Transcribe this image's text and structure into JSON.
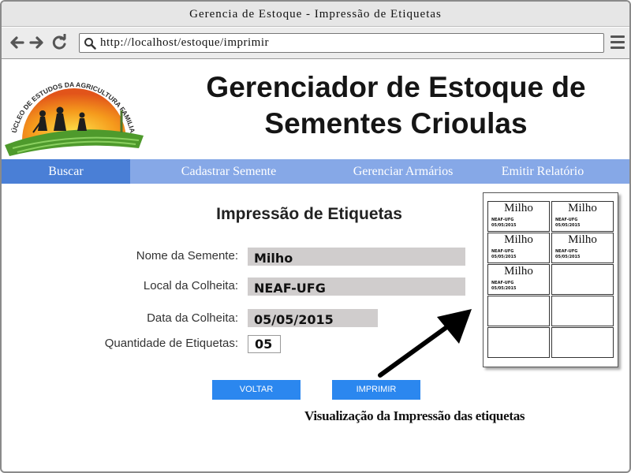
{
  "window": {
    "title": "Gerencia de Estoque - Impressão de Etiquetas"
  },
  "toolbar": {
    "url": "http://localhost/estoque/imprimir",
    "icons": [
      "back-arrow-icon",
      "forward-arrow-icon",
      "reload-icon",
      "search-icon",
      "menu-icon"
    ]
  },
  "header": {
    "logo_text": "NÚCLEO DE ESTUDOS DA AGRICULTURA FAMILIAR",
    "title_line1": "Gerenciador de Estoque de",
    "title_line2": "Sementes Crioulas"
  },
  "nav": {
    "items": [
      {
        "label": "Buscar",
        "active": true
      },
      {
        "label": "Cadastrar Semente",
        "active": false
      },
      {
        "label": "Gerenciar Armários",
        "active": false
      },
      {
        "label": "Emitir Relatório",
        "active": false
      }
    ],
    "colors": {
      "bar": "#86a8e7",
      "active": "#4a7fd6"
    }
  },
  "form": {
    "heading": "Impressão de Etiquetas",
    "fields": [
      {
        "label": "Nome da Semente:",
        "value": "Milho"
      },
      {
        "label": "Local da Colheita:",
        "value": "NEAF-UFG"
      },
      {
        "label": "Data da Colheita:",
        "value": "05/05/2015"
      },
      {
        "label": "Quantidade de Etiquetas:",
        "value": "05"
      }
    ],
    "buttons": {
      "back": "VOLTAR",
      "print": "IMPRIMIR"
    },
    "button_color": "#2b87ef"
  },
  "preview": {
    "labels": [
      {
        "name": "Milho",
        "org": "NEAF-UFG",
        "date": "05/05/2015"
      },
      {
        "name": "Milho",
        "org": "NEAF-UFG",
        "date": "05/05/2015"
      },
      {
        "name": "Milho",
        "org": "NEAF-UFG",
        "date": "05/05/2015"
      },
      {
        "name": "Milho",
        "org": "NEAF-UFG",
        "date": "05/05/2015"
      },
      {
        "name": "Milho",
        "org": "NEAF-UFG",
        "date": "05/05/2015"
      },
      {
        "name": "",
        "org": "",
        "date": ""
      },
      {
        "name": "",
        "org": "",
        "date": ""
      },
      {
        "name": "",
        "org": "",
        "date": ""
      },
      {
        "name": "",
        "org": "",
        "date": ""
      },
      {
        "name": "",
        "org": "",
        "date": ""
      }
    ],
    "caption": "Visualização da Impressão das etiquetas"
  }
}
